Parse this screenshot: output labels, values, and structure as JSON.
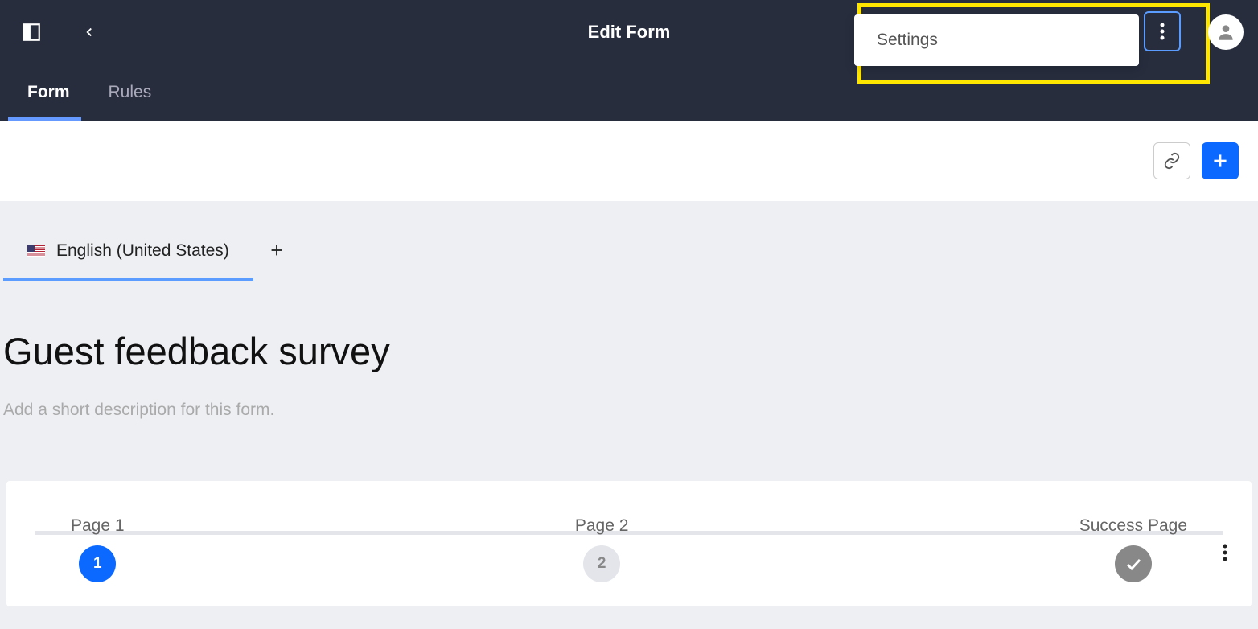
{
  "header": {
    "title": "Edit Form"
  },
  "dropdown": {
    "items": [
      {
        "label": "Settings"
      }
    ]
  },
  "tabs": [
    {
      "label": "Form",
      "active": true
    },
    {
      "label": "Rules",
      "active": false
    }
  ],
  "language": {
    "label": "English (United States)"
  },
  "form": {
    "title": "Guest feedback survey",
    "description_placeholder": "Add a short description for this form."
  },
  "pages": {
    "steps": [
      {
        "label": "Page 1",
        "num": "1",
        "state": "active"
      },
      {
        "label": "Page 2",
        "num": "2",
        "state": "inactive"
      },
      {
        "label": "Success Page",
        "state": "success"
      }
    ]
  }
}
